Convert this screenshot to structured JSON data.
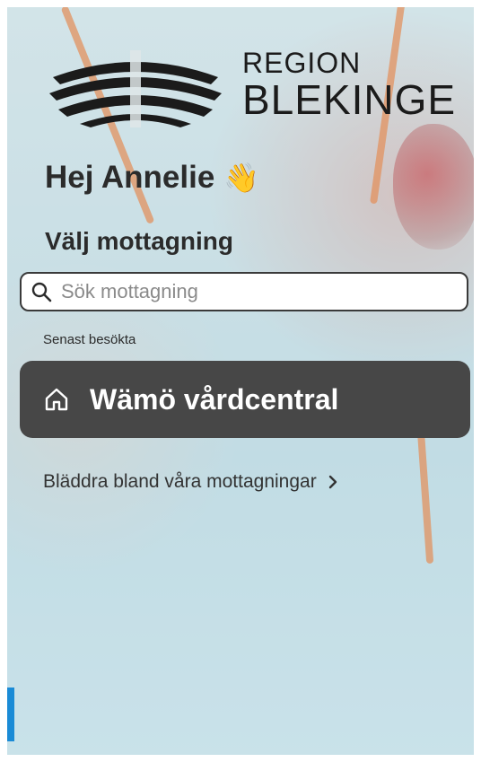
{
  "logo": {
    "line1": "REGION",
    "line2": "BLEKINGE"
  },
  "greeting": {
    "text": "Hej Annelie",
    "emoji": "👋"
  },
  "subtitle": "Välj mottagning",
  "search": {
    "placeholder": "Sök mottagning",
    "value": ""
  },
  "recent": {
    "label": "Senast besökta",
    "items": [
      {
        "name": "Wämö vårdcentral",
        "icon": "home-icon"
      }
    ]
  },
  "browse": {
    "label": "Bläddra bland våra mottagningar",
    "chevron": "›"
  },
  "colors": {
    "card_bg": "#474747",
    "text_dark": "#2b2b2b",
    "accent_blue": "#1a8bd6"
  }
}
